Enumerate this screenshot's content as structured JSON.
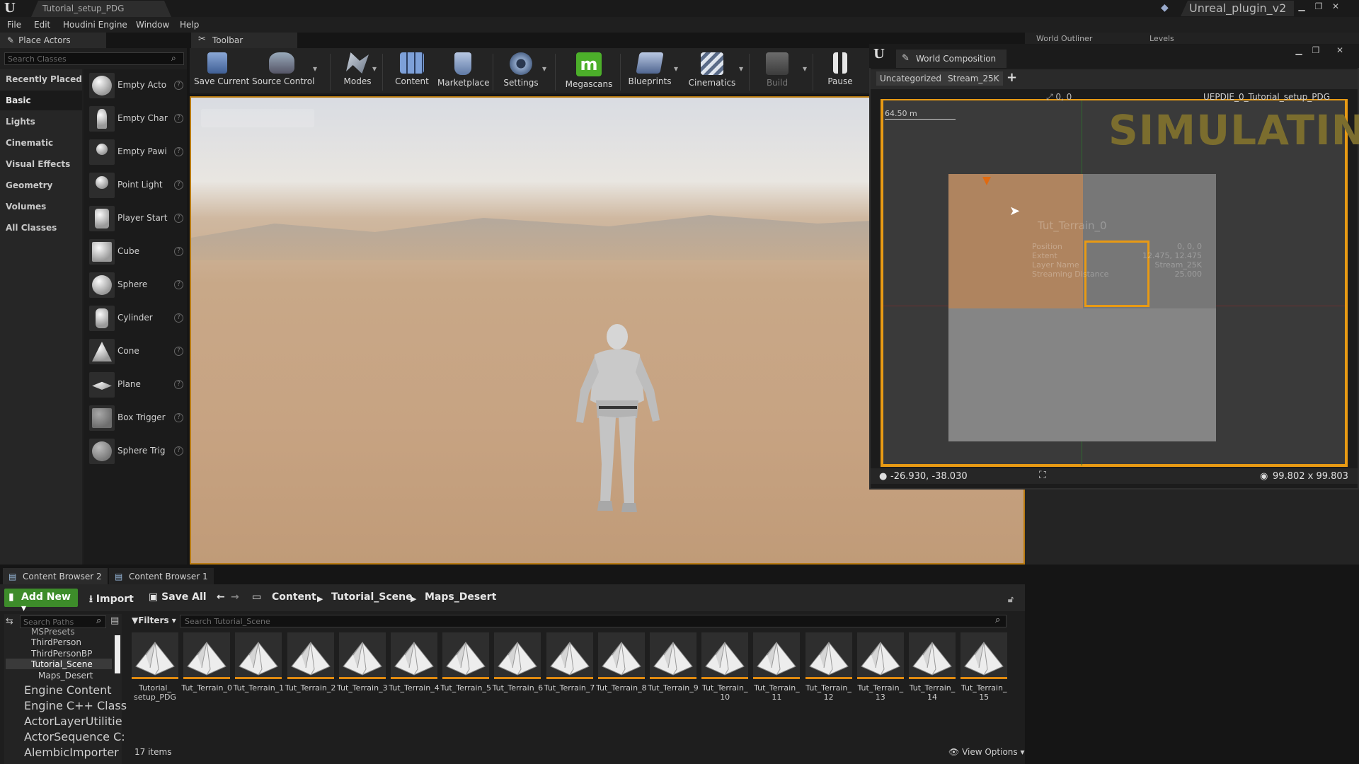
{
  "window": {
    "document_tab": "Tutorial_setup_PDG",
    "project_name": "Unreal_plugin_v2"
  },
  "menu": [
    "File",
    "Edit",
    "Houdini Engine",
    "Window",
    "Help"
  ],
  "place_actors": {
    "tab_title": "Place Actors",
    "search_placeholder": "Search Classes",
    "categories": [
      "Recently Placed",
      "Basic",
      "Lights",
      "Cinematic",
      "Visual Effects",
      "Geometry",
      "Volumes",
      "All Classes"
    ],
    "active_category": "Basic",
    "items": [
      "Empty Acto",
      "Empty Char",
      "Empty Pawi",
      "Point Light",
      "Player Start",
      "Cube",
      "Sphere",
      "Cylinder",
      "Cone",
      "Plane",
      "Box Trigger",
      "Sphere Trig"
    ]
  },
  "toolbar": {
    "tab_title": "Toolbar",
    "buttons": [
      "Save Current",
      "Source Control",
      "Modes",
      "Content",
      "Marketplace",
      "Settings",
      "Megascans",
      "Blueprints",
      "Cinematics",
      "Build",
      "Pause"
    ]
  },
  "outliner_tabs": [
    "World Outliner",
    "Levels"
  ],
  "world_composition": {
    "title": "World Composition",
    "tabs": [
      "Uncategorized",
      "Stream_25K"
    ],
    "add_symbol": "+",
    "origin": "0, 0",
    "map_name": "UEPDIE_0_Tutorial_setup_PDG",
    "scale": "64.50 m",
    "status": "SIMULATING",
    "tile_name": "Tut_Terrain_0",
    "tile_info": [
      {
        "key": "Position",
        "value": "0, 0, 0"
      },
      {
        "key": "Extent",
        "value": "12.475, 12.475"
      },
      {
        "key": "Layer Name",
        "value": "Stream_25K"
      },
      {
        "key": "Streaming Distance",
        "value": "25.000"
      }
    ],
    "cursor_coords": "-26.930, -38.030",
    "world_size": "99.802 x 99.803"
  },
  "content_browser": {
    "tabs": [
      "Content Browser 2",
      "Content Browser 1"
    ],
    "add_new": "Add New",
    "import": "Import",
    "save_all": "Save All",
    "breadcrumb": [
      "Content",
      "Tutorial_Scene",
      "Maps_Desert"
    ],
    "path_search_placeholder": "Search Paths",
    "filters": "Filters",
    "asset_search_placeholder": "Search Tutorial_Scene",
    "tree": [
      "MSPresets",
      "ThirdPerson",
      "ThirdPersonBP",
      "Tutorial_Scene",
      "Maps_Desert"
    ],
    "tree_roots": [
      "Engine Content",
      "Engine C++ Class",
      "ActorLayerUtilitie",
      "ActorSequence C:",
      "AlembicImporter"
    ],
    "assets": [
      "Tutorial_ setup_PDG",
      "Tut_Terrain_0",
      "Tut_Terrain_1",
      "Tut_Terrain_2",
      "Tut_Terrain_3",
      "Tut_Terrain_4",
      "Tut_Terrain_5",
      "Tut_Terrain_6",
      "Tut_Terrain_7",
      "Tut_Terrain_8",
      "Tut_Terrain_9",
      "Tut_Terrain_ 10",
      "Tut_Terrain_ 11",
      "Tut_Terrain_ 12",
      "Tut_Terrain_ 13",
      "Tut_Terrain_ 14",
      "Tut_Terrain_ 15"
    ],
    "item_count": "17 items",
    "view_options": "View Options"
  },
  "colors": {
    "accent_orange": "#e89a14",
    "add_new_green": "#3d8c2a",
    "megascans_green": "#4caf2a"
  }
}
